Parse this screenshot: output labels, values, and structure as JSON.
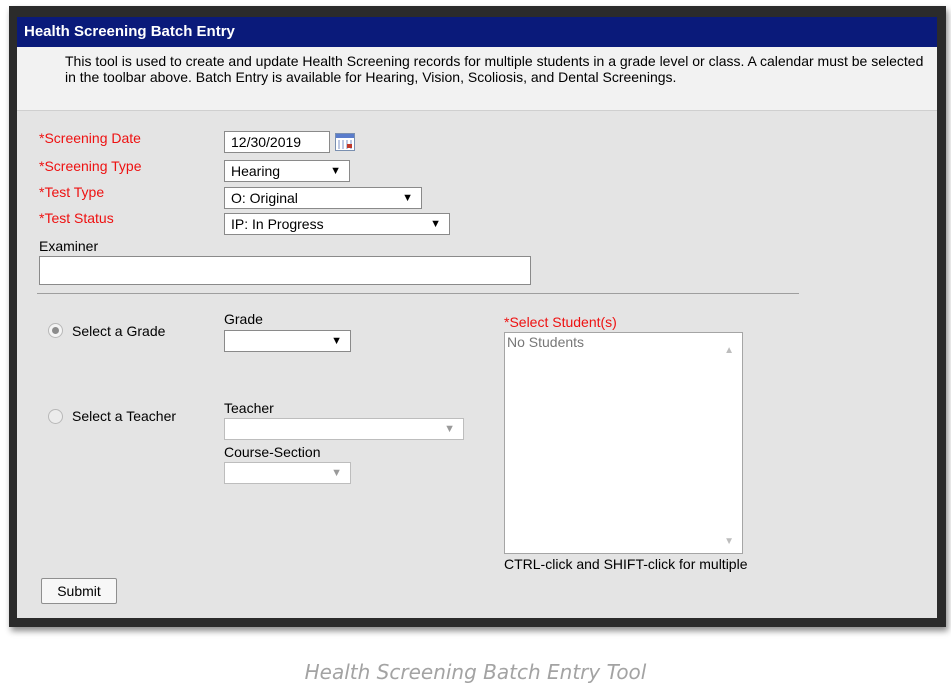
{
  "header": {
    "title": "Health Screening Batch Entry"
  },
  "description": "This tool is used to create and update Health Screening records for multiple students in a grade level or class. A calendar must be selected in the toolbar above. Batch Entry is available for Hearing, Vision, Scoliosis, and Dental Screenings.",
  "fields": {
    "screening_date": {
      "label": "*Screening Date",
      "value": "12/30/2019"
    },
    "screening_type": {
      "label": "*Screening Type",
      "value": "Hearing"
    },
    "test_type": {
      "label": "*Test Type",
      "value": "O: Original"
    },
    "test_status": {
      "label": "*Test Status",
      "value": "IP: In Progress"
    },
    "examiner": {
      "label": "Examiner",
      "value": ""
    }
  },
  "selection": {
    "grade_radio": {
      "label": "Select a Grade",
      "checked": true
    },
    "grade_dropdown": {
      "label": "Grade",
      "value": ""
    },
    "teacher_radio": {
      "label": "Select a Teacher",
      "checked": false
    },
    "teacher_dropdown": {
      "label": "Teacher",
      "value": ""
    },
    "course_section_dropdown": {
      "label": "Course-Section",
      "value": ""
    }
  },
  "students": {
    "label": "*Select Student(s)",
    "items": [
      "No Students"
    ],
    "hint": "CTRL-click and SHIFT-click for multiple"
  },
  "actions": {
    "submit_label": "Submit"
  },
  "caption": "Health Screening Batch Entry Tool",
  "icons": {
    "calendar": "calendar-icon",
    "dropdown": "chevron-down-icon"
  },
  "colors": {
    "header_bg": "#0a1a7a",
    "required_label": "#ee1111",
    "panel_bg": "#e4e4e4"
  }
}
